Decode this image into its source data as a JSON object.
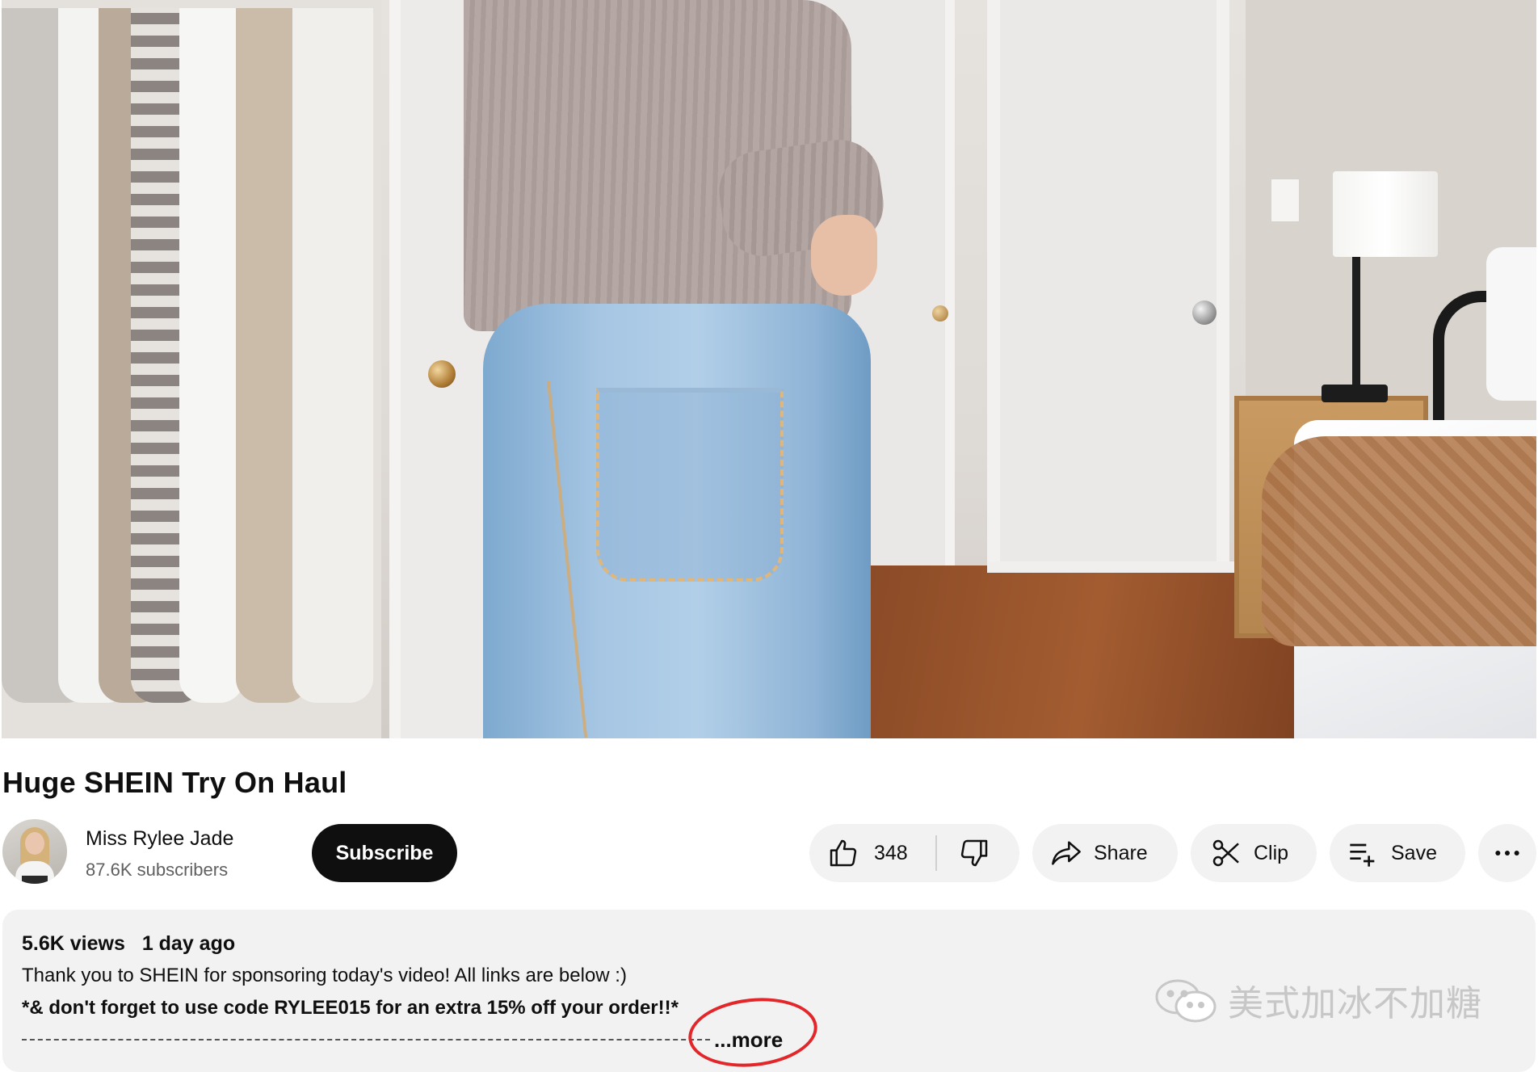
{
  "video": {
    "title": "Huge SHEIN Try On Haul"
  },
  "channel": {
    "name": "Miss Rylee Jade",
    "subscribers": "87.6K subscribers",
    "subscribe_label": "Subscribe"
  },
  "actions": {
    "like_count": "348",
    "share_label": "Share",
    "clip_label": "Clip",
    "save_label": "Save"
  },
  "description": {
    "views": "5.6K views",
    "date": "1 day ago",
    "line1": "Thank you to SHEIN for sponsoring today's video! All links are below :)",
    "line2": "*& don't forget to use code RYLEE015 for an extra 15% off your order!!*",
    "more_label": "...more"
  },
  "watermark": {
    "text": "美式加冰不加糖"
  },
  "colors": {
    "subscribe_bg": "#0f0f0f",
    "pill_bg": "#f2f2f2",
    "annotation_red": "#e3262a"
  }
}
